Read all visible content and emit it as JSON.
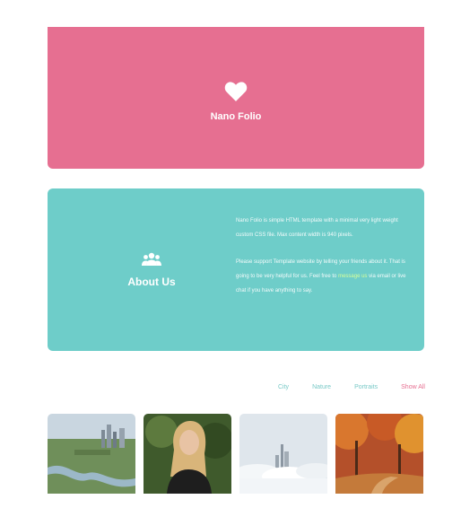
{
  "hero": {
    "icon": "heart-icon",
    "title": "Nano Folio",
    "background": "#e66f91"
  },
  "about": {
    "icon": "users-group-icon",
    "heading": "About Us",
    "background": "#6ecdc9",
    "paragraph1": "Nano Folio is simple HTML template with a minimal very light weight custom CSS file. Max content width is 940 pixels.",
    "paragraph2_before": "Please support Template website by telling your friends about it. That is going to be very helpful for us. Feel free to",
    "paragraph2_link": "message us",
    "paragraph2_after": "via email or live chat if you have anything to say."
  },
  "filters": {
    "items": [
      "City",
      "Nature",
      "Portraits",
      "Show All"
    ],
    "active_color": "#e66f91",
    "inactive_color": "#79c9c7"
  },
  "gallery": {
    "images": [
      "city-river-aerial",
      "portrait-woman",
      "city-in-clouds",
      "autumn-forest-path"
    ]
  }
}
